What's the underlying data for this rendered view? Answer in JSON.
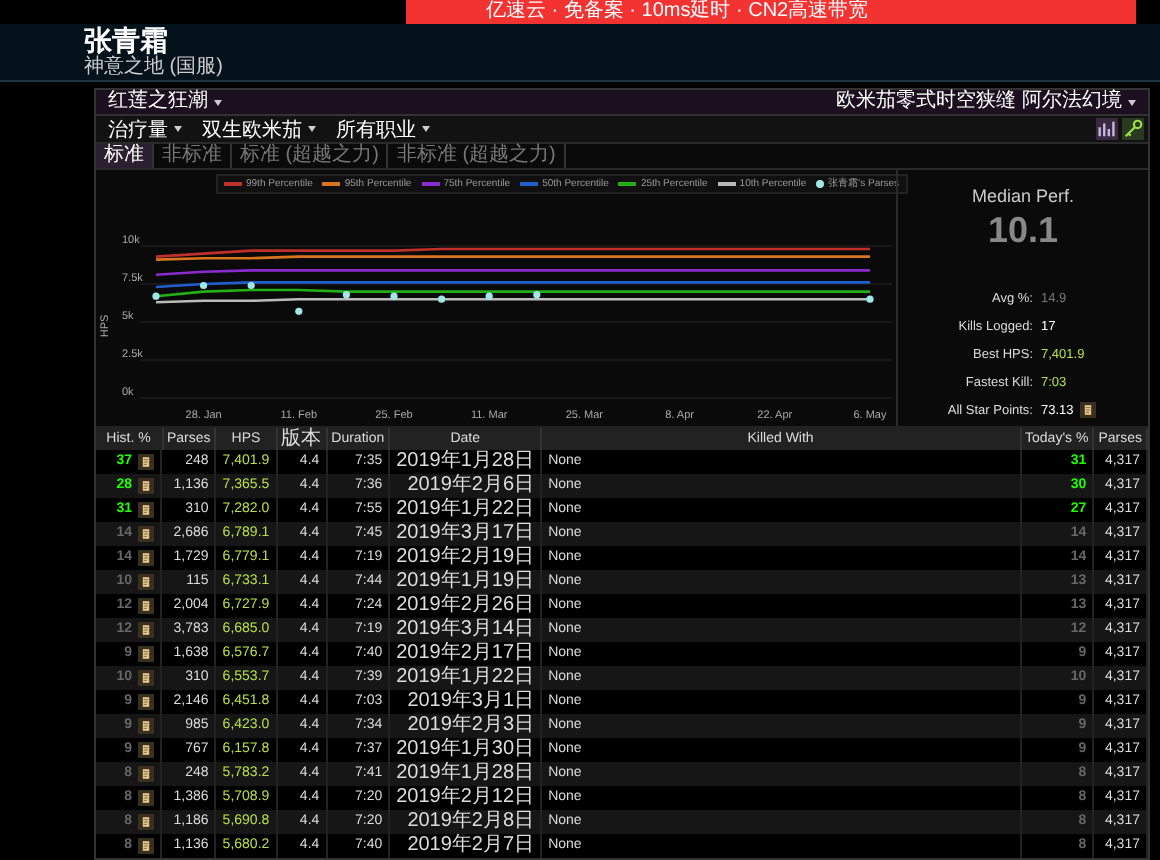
{
  "ad_banner": {
    "text": "亿速云 · 免备案 · 10ms延时 · CN2高速带宽"
  },
  "character": {
    "name": "张青霜",
    "server": "神意之地 (国服)"
  },
  "zone_menu": {
    "left": "红莲之狂潮",
    "right": "欧米茄零式时空狭缝 阿尔法幻境"
  },
  "filters": [
    {
      "label": "治疗量"
    },
    {
      "label": "双生欧米茄"
    },
    {
      "label": "所有职业"
    }
  ],
  "tabs": [
    {
      "label": "标准",
      "selected": true
    },
    {
      "label": "非标准",
      "selected": false
    },
    {
      "label": "标准 (超越之力)",
      "selected": false
    },
    {
      "label": "非标准 (超越之力)",
      "selected": false
    }
  ],
  "chart_data": {
    "type": "line",
    "grid": true,
    "legend": true,
    "ylabel": "HPS",
    "categories": [
      null,
      "28. Jan",
      null,
      "11. Feb",
      null,
      "25. Feb",
      null,
      "11. Mar",
      null,
      "25. Mar",
      null,
      "8. Apr",
      null,
      "22. Apr",
      null,
      "6. May"
    ],
    "ylim": [
      0,
      10000
    ],
    "yticks": [
      {
        "value": 0,
        "label": "0k"
      },
      {
        "value": 2500,
        "label": "2.5k"
      },
      {
        "value": 5000,
        "label": "5k"
      },
      {
        "value": 7500,
        "label": "7.5k"
      },
      {
        "value": 10000,
        "label": "10k"
      }
    ],
    "series": [
      {
        "name": "99th Percentile",
        "color": "#c0302a",
        "values": [
          9300,
          9500,
          9700,
          9700,
          9700,
          9700,
          9800,
          9800,
          9800,
          9800,
          9800,
          9800,
          9800,
          9800,
          9800,
          9800
        ]
      },
      {
        "name": "95th Percentile",
        "color": "#d9741a",
        "values": [
          9100,
          9200,
          9200,
          9300,
          9300,
          9300,
          9300,
          9300,
          9300,
          9300,
          9300,
          9300,
          9300,
          9300,
          9300,
          9300
        ]
      },
      {
        "name": "75th Percentile",
        "color": "#8a2bd0",
        "values": [
          8100,
          8300,
          8400,
          8400,
          8400,
          8400,
          8400,
          8400,
          8400,
          8400,
          8400,
          8400,
          8400,
          8400,
          8400,
          8400
        ]
      },
      {
        "name": "50th Percentile",
        "color": "#1f5fd0",
        "values": [
          7300,
          7500,
          7600,
          7600,
          7600,
          7600,
          7600,
          7600,
          7600,
          7600,
          7600,
          7600,
          7600,
          7600,
          7600,
          7600
        ]
      },
      {
        "name": "25th Percentile",
        "color": "#22b014",
        "values": [
          6700,
          7000,
          7100,
          7100,
          7000,
          7000,
          7000,
          7000,
          7000,
          7000,
          7000,
          7000,
          7000,
          7000,
          7000,
          7000
        ]
      },
      {
        "name": "10th Percentile",
        "color": "#bbbbbb",
        "values": [
          6300,
          6400,
          6400,
          6500,
          6500,
          6500,
          6500,
          6500,
          6500,
          6500,
          6500,
          6500,
          6500,
          6500,
          6500,
          6500
        ]
      },
      {
        "name": "张青霜's Parses",
        "color": "#a0e8e8",
        "type": "scatter",
        "values": [
          6700,
          7400,
          7400,
          5700,
          6800,
          6700,
          6500,
          6700,
          6800,
          null,
          null,
          null,
          null,
          null,
          null,
          6500
        ]
      }
    ]
  },
  "summary": {
    "title": "Median Perf.",
    "value": "10.1",
    "stats": [
      {
        "label": "Avg %:",
        "value": "14.9",
        "kind": "muted"
      },
      {
        "label": "Kills Logged:",
        "value": "17",
        "kind": "plain"
      },
      {
        "label": "Best HPS:",
        "value": "7,401.9",
        "kind": "good"
      },
      {
        "label": "Fastest Kill:",
        "value": "7:03",
        "kind": "good"
      },
      {
        "label": "All Star Points:",
        "value": "73.13",
        "kind": "points"
      }
    ]
  },
  "table": {
    "columns": [
      "Hist. %",
      "Parses",
      "HPS",
      "版本",
      "Duration",
      "Date",
      "Killed With",
      "Today's %",
      "Parses"
    ],
    "rows": [
      {
        "hist": "37",
        "color": "#1eff00",
        "parses": "248",
        "hps": "7,401.9",
        "version": "4.4",
        "duration": "7:35",
        "date": "2019年1月28日",
        "killed_with": "None",
        "today": "31",
        "today_parses": "4,317"
      },
      {
        "hist": "28",
        "color": "#1eff00",
        "parses": "1,136",
        "hps": "7,365.5",
        "version": "4.4",
        "duration": "7:36",
        "date": "2019年2月6日",
        "killed_with": "None",
        "today": "30",
        "today_parses": "4,317"
      },
      {
        "hist": "31",
        "color": "#1eff00",
        "parses": "310",
        "hps": "7,282.0",
        "version": "4.4",
        "duration": "7:55",
        "date": "2019年1月22日",
        "killed_with": "None",
        "today": "27",
        "today_parses": "4,317"
      },
      {
        "hist": "14",
        "color": "#666666",
        "parses": "2,686",
        "hps": "6,789.1",
        "version": "4.4",
        "duration": "7:45",
        "date": "2019年3月17日",
        "killed_with": "None",
        "today": "14",
        "today_parses": "4,317"
      },
      {
        "hist": "14",
        "color": "#666666",
        "parses": "1,729",
        "hps": "6,779.1",
        "version": "4.4",
        "duration": "7:19",
        "date": "2019年2月19日",
        "killed_with": "None",
        "today": "14",
        "today_parses": "4,317"
      },
      {
        "hist": "10",
        "color": "#666666",
        "parses": "115",
        "hps": "6,733.1",
        "version": "4.4",
        "duration": "7:44",
        "date": "2019年1月19日",
        "killed_with": "None",
        "today": "13",
        "today_parses": "4,317"
      },
      {
        "hist": "12",
        "color": "#666666",
        "parses": "2,004",
        "hps": "6,727.9",
        "version": "4.4",
        "duration": "7:24",
        "date": "2019年2月26日",
        "killed_with": "None",
        "today": "13",
        "today_parses": "4,317"
      },
      {
        "hist": "12",
        "color": "#666666",
        "parses": "3,783",
        "hps": "6,685.0",
        "version": "4.4",
        "duration": "7:19",
        "date": "2019年3月14日",
        "killed_with": "None",
        "today": "12",
        "today_parses": "4,317"
      },
      {
        "hist": "9",
        "color": "#666666",
        "parses": "1,638",
        "hps": "6,576.7",
        "version": "4.4",
        "duration": "7:40",
        "date": "2019年2月17日",
        "killed_with": "None",
        "today": "9",
        "today_parses": "4,317"
      },
      {
        "hist": "10",
        "color": "#666666",
        "parses": "310",
        "hps": "6,553.7",
        "version": "4.4",
        "duration": "7:39",
        "date": "2019年1月22日",
        "killed_with": "None",
        "today": "10",
        "today_parses": "4,317"
      },
      {
        "hist": "9",
        "color": "#666666",
        "parses": "2,146",
        "hps": "6,451.8",
        "version": "4.4",
        "duration": "7:03",
        "date": "2019年3月1日",
        "killed_with": "None",
        "today": "9",
        "today_parses": "4,317"
      },
      {
        "hist": "9",
        "color": "#666666",
        "parses": "985",
        "hps": "6,423.0",
        "version": "4.4",
        "duration": "7:34",
        "date": "2019年2月3日",
        "killed_with": "None",
        "today": "9",
        "today_parses": "4,317"
      },
      {
        "hist": "9",
        "color": "#666666",
        "parses": "767",
        "hps": "6,157.8",
        "version": "4.4",
        "duration": "7:37",
        "date": "2019年1月30日",
        "killed_with": "None",
        "today": "9",
        "today_parses": "4,317"
      },
      {
        "hist": "8",
        "color": "#666666",
        "parses": "248",
        "hps": "5,783.2",
        "version": "4.4",
        "duration": "7:41",
        "date": "2019年1月28日",
        "killed_with": "None",
        "today": "8",
        "today_parses": "4,317"
      },
      {
        "hist": "8",
        "color": "#666666",
        "parses": "1,386",
        "hps": "5,708.9",
        "version": "4.4",
        "duration": "7:20",
        "date": "2019年2月12日",
        "killed_with": "None",
        "today": "8",
        "today_parses": "4,317"
      },
      {
        "hist": "8",
        "color": "#666666",
        "parses": "1,186",
        "hps": "5,690.8",
        "version": "4.4",
        "duration": "7:20",
        "date": "2019年2月8日",
        "killed_with": "None",
        "today": "8",
        "today_parses": "4,317"
      },
      {
        "hist": "8",
        "color": "#666666",
        "parses": "1,136",
        "hps": "5,680.2",
        "version": "4.4",
        "duration": "7:40",
        "date": "2019年2月7日",
        "killed_with": "None",
        "today": "8",
        "today_parses": "4,317"
      }
    ]
  }
}
